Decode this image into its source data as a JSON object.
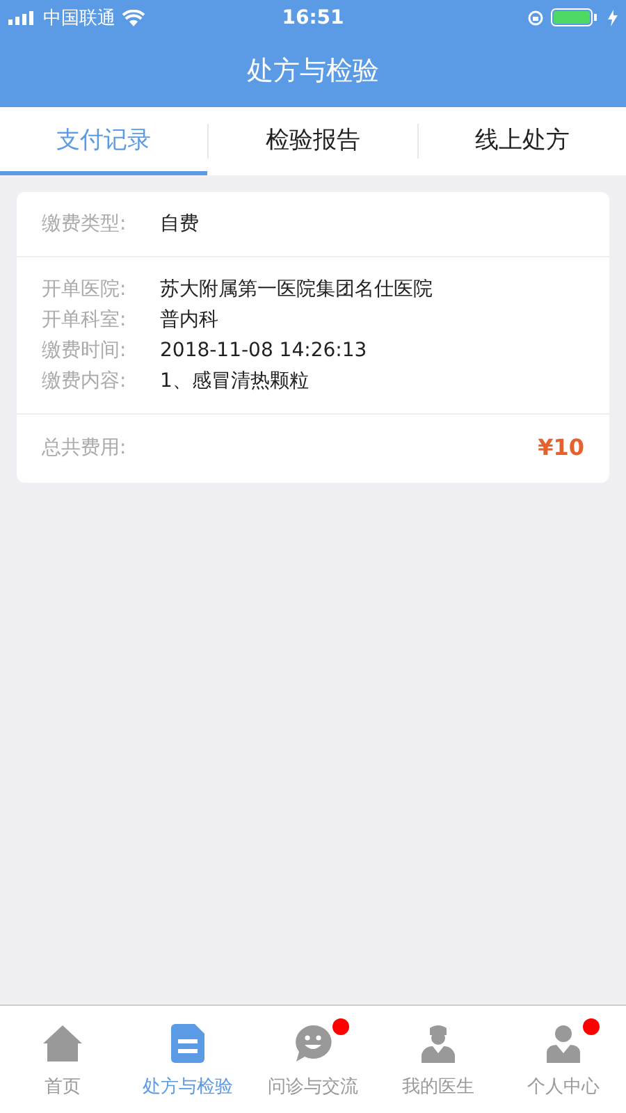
{
  "status_bar": {
    "carrier": "中国联通",
    "time": "16:51"
  },
  "header": {
    "title": "处方与检验"
  },
  "tabs": [
    {
      "label": "支付记录",
      "selected": true
    },
    {
      "label": "检验报告",
      "selected": false
    },
    {
      "label": "线上处方",
      "selected": false
    }
  ],
  "record": {
    "sections": [
      [
        {
          "label": "缴费类型:",
          "value": "自费"
        }
      ],
      [
        {
          "label": "开单医院:",
          "value": "苏大附属第一医院集团名仕医院"
        },
        {
          "label": "开单科室:",
          "value": "普内科"
        },
        {
          "label": "缴费时间:",
          "value": "2018-11-08 14:26:13"
        },
        {
          "label": "缴费内容:",
          "value": "1、感冒清热颗粒"
        }
      ]
    ],
    "total_label": "总共费用:",
    "total": "¥10"
  },
  "bottom_nav": [
    {
      "kind": "home",
      "label": "首页",
      "selected": false,
      "badge": false
    },
    {
      "kind": "document",
      "label": "处方与检验",
      "selected": true,
      "badge": false
    },
    {
      "kind": "chat",
      "label": "问诊与交流",
      "selected": false,
      "badge": true
    },
    {
      "kind": "doctor",
      "label": "我的医生",
      "selected": false,
      "badge": false
    },
    {
      "kind": "person",
      "label": "个人中心",
      "selected": false,
      "badge": true
    }
  ]
}
